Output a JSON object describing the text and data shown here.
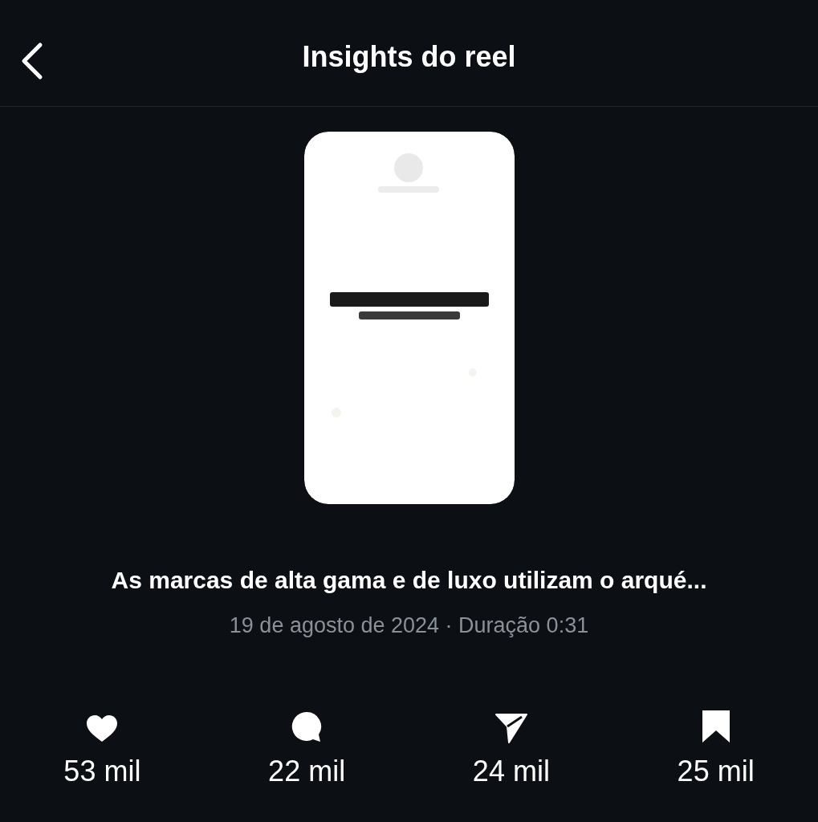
{
  "header": {
    "title": "Insights do reel"
  },
  "caption": "As marcas de alta gama e de luxo utilizam o arqué...",
  "meta": "19 de agosto de 2024 · Duração 0:31",
  "stats": [
    {
      "kind": "likes",
      "value": "53 mil"
    },
    {
      "kind": "comments",
      "value": "22 mil"
    },
    {
      "kind": "shares",
      "value": "24 mil"
    },
    {
      "kind": "saves",
      "value": "25 mil"
    }
  ]
}
